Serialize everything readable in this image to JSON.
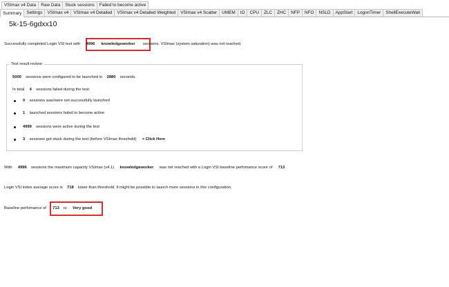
{
  "tabs_top": [
    "VSImax v4 Data",
    "Raw Data",
    "Stuck sessions",
    "Failed to become active"
  ],
  "tabs_main": [
    "Summary",
    "Settings",
    "VSImax v4",
    "VSImax v4 Detailed",
    "VSImax v4 Detailed Weighted",
    "VSImax v4 Scatter",
    "UMEM",
    "IO",
    "CPU",
    "ZLC",
    "ZHC",
    "NFP",
    "NFO",
    "NSLD",
    "AppStart",
    "LogonTimer",
    "ShellExecuteWait"
  ],
  "title": "5k-15-6gdxx10",
  "summary": {
    "prefix": "Successfully completed Login VSI test with",
    "sessions": "4996",
    "workload": "knowledgeworker",
    "suffix": "sessions. VSImax (system saturation) was not reached."
  },
  "review": {
    "legend": "Test result review",
    "configured_sessions": "5000",
    "configured_text": "sessions were configured to be launched in",
    "seconds": "2880",
    "seconds_text": "seconds.",
    "in_total_text": "In total",
    "failed_count": "4",
    "failed_text": "sessions failed during the test:",
    "items": [
      {
        "value": "0",
        "text": "sessions was/were not successfully launched"
      },
      {
        "value": "1",
        "text": "launched sessions failed to become active"
      },
      {
        "value": "4999",
        "text": "sessions were active during the test"
      },
      {
        "value": "3",
        "text": "sessions got stuck during the test (before VSImax threshold)"
      }
    ],
    "click_here": "> Click Here"
  },
  "capacity": {
    "prefix": "With",
    "sessions": "4996",
    "middle": "sessions the maximum capacity VSImax (v4.1)",
    "workload": "knowledgeworker",
    "after": "was not reached with a Login VSI baseline perfomance score of",
    "score": "713"
  },
  "average": {
    "prefix": "Login VSI index average score is",
    "score": "718",
    "suffix": "lower than threshold. It might be possible to launch more sessions in this configuration."
  },
  "baseline": {
    "prefix": "Baseline perfomance of",
    "score": "713",
    "is_text": "is:",
    "rating": "Very good"
  }
}
